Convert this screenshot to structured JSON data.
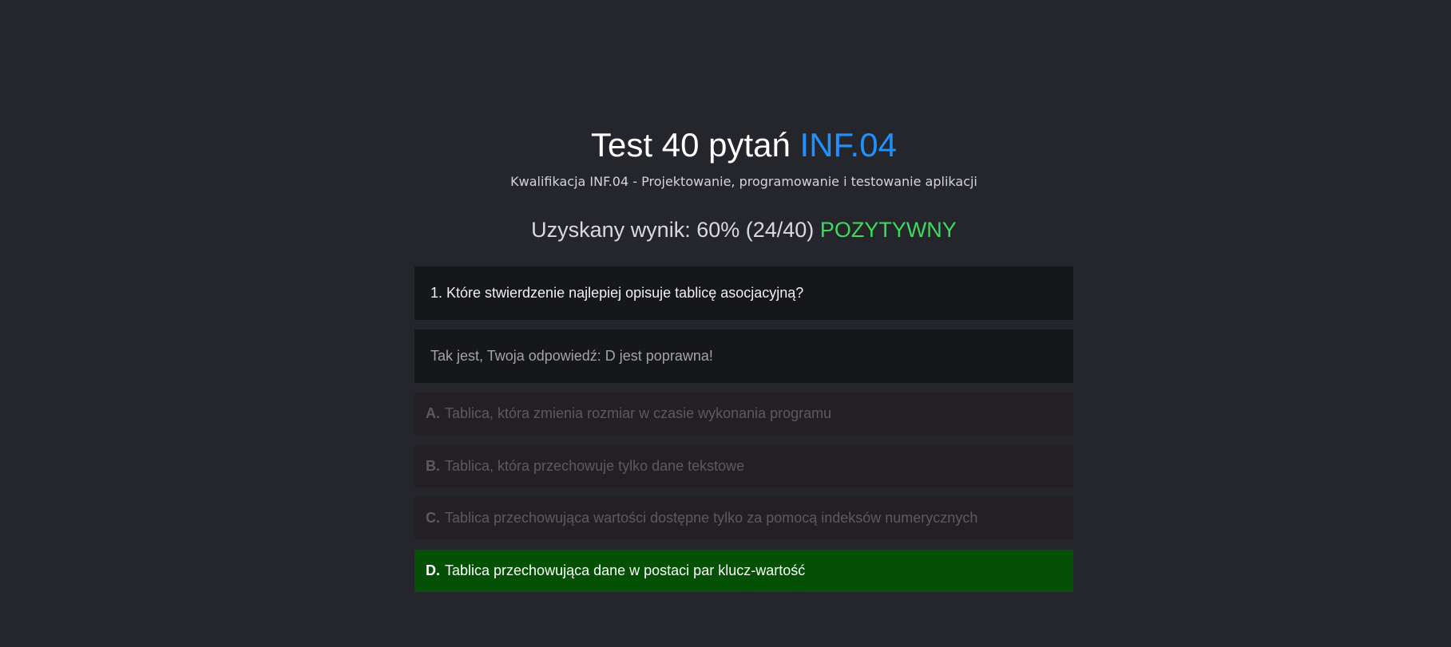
{
  "header": {
    "title_main": "Test 40 pytań",
    "title_accent": "INF.04",
    "subtitle": "Kwalifikacja INF.04 - Projektowanie, programowanie i testowanie aplikacji"
  },
  "result": {
    "label": "Uzyskany wynik: 60% (24/40)",
    "status": "POZYTYWNY",
    "percent": 60,
    "correct": 24,
    "total": 40
  },
  "question": {
    "text": "1. Które stwierdzenie najlepiej opisuje tablicę asocjacyjną?"
  },
  "feedback": {
    "text": "Tak jest, Twoja odpowiedź: D jest poprawna!"
  },
  "answers": [
    {
      "letter": "A.",
      "text": "Tablica, która zmienia rozmiar w czasie wykonania programu"
    },
    {
      "letter": "B.",
      "text": "Tablica, która przechowuje tylko dane tekstowe"
    },
    {
      "letter": "C.",
      "text": "Tablica przechowująca wartości dostępne tylko za pomocą indeksów numerycznych"
    },
    {
      "letter": "D.",
      "text": "Tablica przechowująca dane w postaci par klucz-wartość"
    }
  ],
  "colors": {
    "background": "#25262c",
    "accent": "#1e90ff",
    "positive": "#3ed95e",
    "correct_answer_bg": "#045004",
    "answer_bg": "#241f23"
  }
}
